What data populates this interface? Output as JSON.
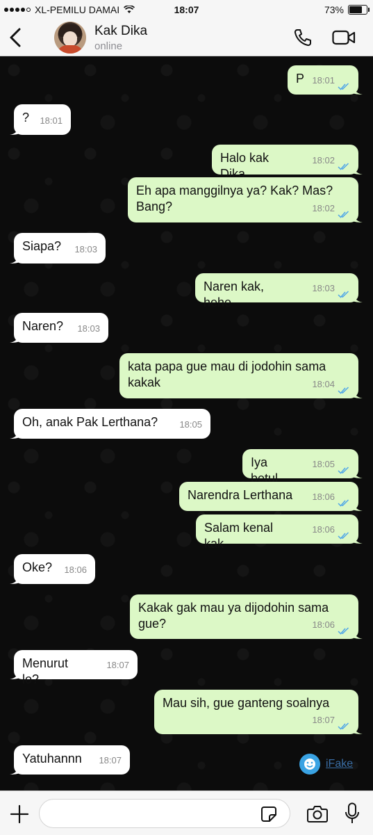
{
  "status_bar": {
    "carrier": "XL-PEMILU DAMAI",
    "time": "18:07",
    "battery": "73%",
    "battery_level": 0.73
  },
  "header": {
    "contact_name": "Kak Dika",
    "status": "online",
    "icons": [
      "back-chevron-icon",
      "phone-icon",
      "video-camera-icon"
    ]
  },
  "messages": [
    {
      "dir": "out",
      "text": "P",
      "time": "18:01"
    },
    {
      "dir": "in",
      "text": "?",
      "time": "18:01"
    },
    {
      "dir": "out",
      "text": "Halo kak Dika",
      "time": "18:02"
    },
    {
      "dir": "out",
      "text": "Eh apa manggilnya ya? Kak? Mas? Bang?",
      "time": "18:02"
    },
    {
      "dir": "in",
      "text": "Siapa?",
      "time": "18:03"
    },
    {
      "dir": "out",
      "text": "Naren kak, hehe",
      "time": "18:03"
    },
    {
      "dir": "in",
      "text": "Naren?",
      "time": "18:03"
    },
    {
      "dir": "out",
      "text": "kata papa gue mau di jodohin sama kakak",
      "time": "18:04"
    },
    {
      "dir": "in",
      "text": "Oh, anak Pak Lerthana?",
      "time": "18:05"
    },
    {
      "dir": "out",
      "text": "Iya betul",
      "time": "18:05"
    },
    {
      "dir": "out",
      "text": "Narendra Lerthana",
      "time": "18:06"
    },
    {
      "dir": "out",
      "text": "Salam kenal kak",
      "time": "18:06"
    },
    {
      "dir": "in",
      "text": "Oke?",
      "time": "18:06"
    },
    {
      "dir": "out",
      "text": "Kakak gak mau ya dijodohin sama gue?",
      "time": "18:06"
    },
    {
      "dir": "in",
      "text": "Menurut lo?",
      "time": "18:07"
    },
    {
      "dir": "out",
      "text": "Mau sih, gue ganteng soalnya",
      "time": "18:07"
    },
    {
      "dir": "in",
      "text": "Yatuhannn",
      "time": "18:07"
    }
  ],
  "watermark": "iFake",
  "colors": {
    "outgoing_bubble": "#dcf8c6",
    "incoming_bubble": "#ffffff",
    "read_tick": "#4fa6e8"
  },
  "input_bar": {
    "icons": [
      "plus-icon",
      "sticker-icon",
      "camera-icon",
      "microphone-icon"
    ]
  }
}
